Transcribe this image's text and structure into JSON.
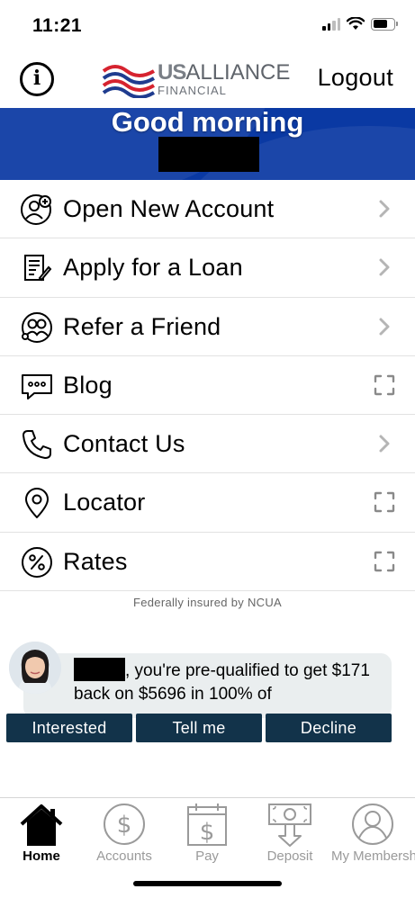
{
  "status_bar": {
    "time": "11:21"
  },
  "header": {
    "logo": {
      "us": "US",
      "alliance": "ALLIANCE",
      "financial": "FINANCIAL"
    },
    "logout_label": "Logout"
  },
  "banner": {
    "greeting": "Good morning"
  },
  "menu": {
    "items": [
      {
        "label": "Open New Account",
        "icon": "add-person-icon",
        "trail": "chevron-right-icon"
      },
      {
        "label": "Apply for a Loan",
        "icon": "document-pen-icon",
        "trail": "chevron-right-icon"
      },
      {
        "label": "Refer a Friend",
        "icon": "friends-icon",
        "trail": "chevron-right-icon"
      },
      {
        "label": "Blog",
        "icon": "chat-bubble-icon",
        "trail": "expand-icon"
      },
      {
        "label": "Contact Us",
        "icon": "phone-icon",
        "trail": "chevron-right-icon"
      },
      {
        "label": "Locator",
        "icon": "location-pin-icon",
        "trail": "expand-icon"
      },
      {
        "label": "Rates",
        "icon": "percent-icon",
        "trail": "expand-icon"
      }
    ]
  },
  "footnote": "Federally insured by NCUA",
  "promo": {
    "message": ", you're pre-qualified to get $171 back on $5696 in 100% of",
    "buttons": {
      "interested": "Interested",
      "tell_me": "Tell me",
      "decline": "Decline"
    }
  },
  "tabbar": {
    "tabs": [
      {
        "label": "Home",
        "icon": "home-icon",
        "active": true
      },
      {
        "label": "Accounts",
        "icon": "dollar-circle-icon",
        "active": false
      },
      {
        "label": "Pay",
        "icon": "calendar-dollar-icon",
        "active": false
      },
      {
        "label": "Deposit",
        "icon": "deposit-check-icon",
        "active": false
      },
      {
        "label": "My Membership",
        "icon": "person-circle-icon",
        "active": false
      }
    ]
  },
  "colors": {
    "banner": "#0a39a3",
    "promo_button": "#12334a",
    "logo_red": "#d6232f",
    "logo_blue": "#1f3c8f"
  }
}
